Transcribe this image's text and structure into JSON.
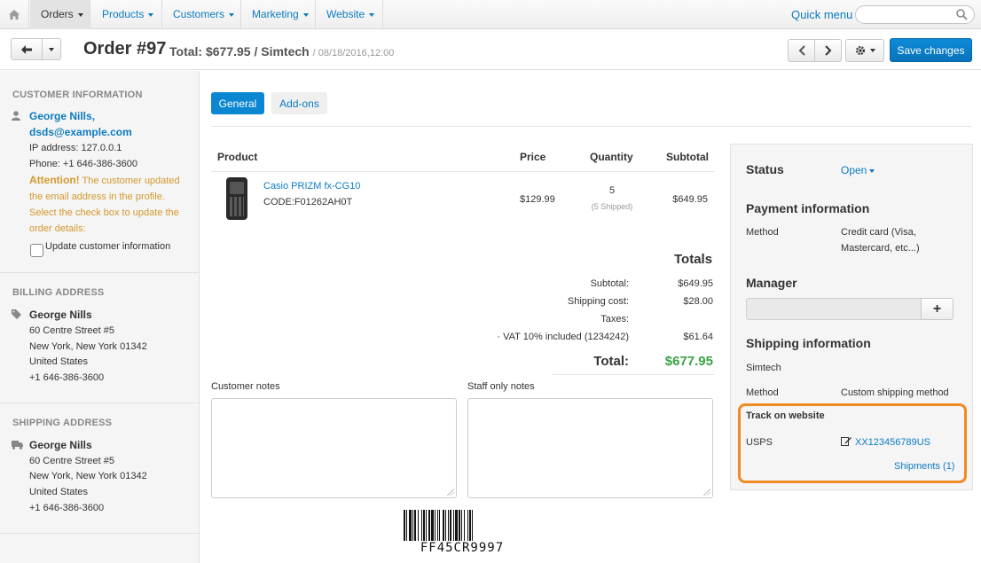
{
  "nav": {
    "items": [
      "Orders",
      "Products",
      "Customers",
      "Marketing",
      "Website"
    ],
    "quick_menu": "Quick menu",
    "search_placeholder": ""
  },
  "header": {
    "title": "Order #97",
    "total": "Total: $677.95",
    "vendor": "Simtech",
    "date": "08/18/2016,12:00",
    "save": "Save changes"
  },
  "sidebar": {
    "customer": {
      "heading": "CUSTOMER INFORMATION",
      "name": "George Nills,",
      "email": "dsds@example.com",
      "ip": "IP address: 127.0.0.1",
      "phone": "Phone: +1 646-386-3600",
      "attention_label": "Attention!",
      "attention_text": " The customer updated the email address in the profile. Select the check box to update the order details:",
      "checkbox_label": "Update customer information"
    },
    "billing": {
      "heading": "BILLING ADDRESS",
      "name": "George Nills",
      "street": "60 Centre Street #5",
      "city": "New York, New York 01342",
      "country": "United States",
      "phone": "+1 646-386-3600"
    },
    "shipping": {
      "heading": "SHIPPING ADDRESS",
      "name": "George Nills",
      "street": "60 Centre Street #5",
      "city": "New York, New York 01342",
      "country": "United States",
      "phone": "+1 646-386-3600"
    }
  },
  "tabs": [
    "General",
    "Add-ons"
  ],
  "products": {
    "headers": [
      "Product",
      "Price",
      "Quantity",
      "Subtotal"
    ],
    "rows": [
      {
        "name": "Casio PRIZM fx-CG10",
        "code": "CODE:F01262AH0T",
        "price": "$129.99",
        "qty": "5",
        "shipped": "(5 Shipped)",
        "subtotal": "$649.95"
      }
    ]
  },
  "totals": {
    "title": "Totals",
    "subtotal_label": "Subtotal:",
    "subtotal": "$649.95",
    "shipping_label": "Shipping cost:",
    "shipping": "$28.00",
    "taxes_label": "Taxes:",
    "vat_label": "· VAT 10% included (1234242)",
    "vat": "$61.64",
    "total_label": "Total:",
    "total": "$677.95"
  },
  "notes": {
    "customer_label": "Customer notes",
    "staff_label": "Staff only notes"
  },
  "barcode": "FF45CR9997",
  "panel": {
    "status_label": "Status",
    "status_value": "Open",
    "payment_heading": "Payment information",
    "method_label": "Method",
    "payment_method": "Credit card (Visa, Mastercard, etc...)",
    "manager_heading": "Manager",
    "manager_add": "+",
    "shipping_heading": "Shipping information",
    "shipping_vendor": "Simtech",
    "shipping_method": "Custom shipping method",
    "track_heading": "Track on website",
    "carrier": "USPS",
    "tracking": "XX123456789US",
    "shipments": "Shipments (1)"
  },
  "colors": {
    "accent": "#0b86d1",
    "link": "#0b7bc1",
    "total_green": "#3aa345",
    "attention": "#d4992d",
    "highlight": "#f08a24"
  }
}
